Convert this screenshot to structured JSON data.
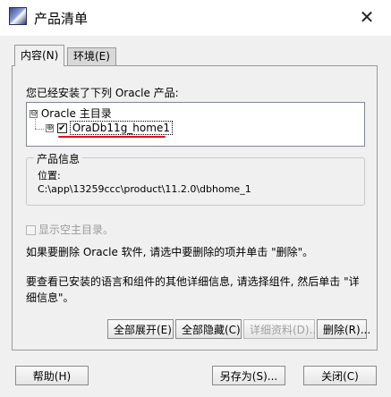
{
  "window": {
    "title": "产品清单",
    "close_icon": "close-icon"
  },
  "tabs": [
    {
      "label": "内容(N)",
      "active": true
    },
    {
      "label": "环境(E)",
      "active": false
    }
  ],
  "content": {
    "installed_label": "您已经安装了下列 Oracle 产品:",
    "tree": {
      "root": {
        "label": "Oracle 主目录",
        "expander": "⊖"
      },
      "child": {
        "label": "OraDb11g_home1",
        "expander": "⊕",
        "checked": true,
        "check_glyph": "☑"
      }
    },
    "product_info": {
      "title": "产品信息",
      "location_label": "位置:",
      "path": "C:\\app\\13259ccc\\product\\11.2.0\\dbhome_1"
    },
    "show_empty": {
      "label": "显示空主目录。",
      "checked": false,
      "enabled": false
    },
    "help_delete": "如果要删除 Oracle 软件, 请选中要删除的项并单击 \"删除\"。",
    "help_details": "要查看已安装的语言和组件的其他详细信息, 请选择组件, 然后单击 \"详细信息\"。",
    "buttons": {
      "expand_all": "全部展开(E)",
      "collapse_all": "全部隐藏(C)",
      "details": "详细资料(D)...",
      "delete": "删除(R)..."
    }
  },
  "footer": {
    "help": "帮助(H)",
    "save_as": "另存为(S)...",
    "close": "关闭(C)"
  },
  "colors": {
    "highlight_underline": "#e8001c",
    "dialog_bg": "#f0f0f0"
  }
}
